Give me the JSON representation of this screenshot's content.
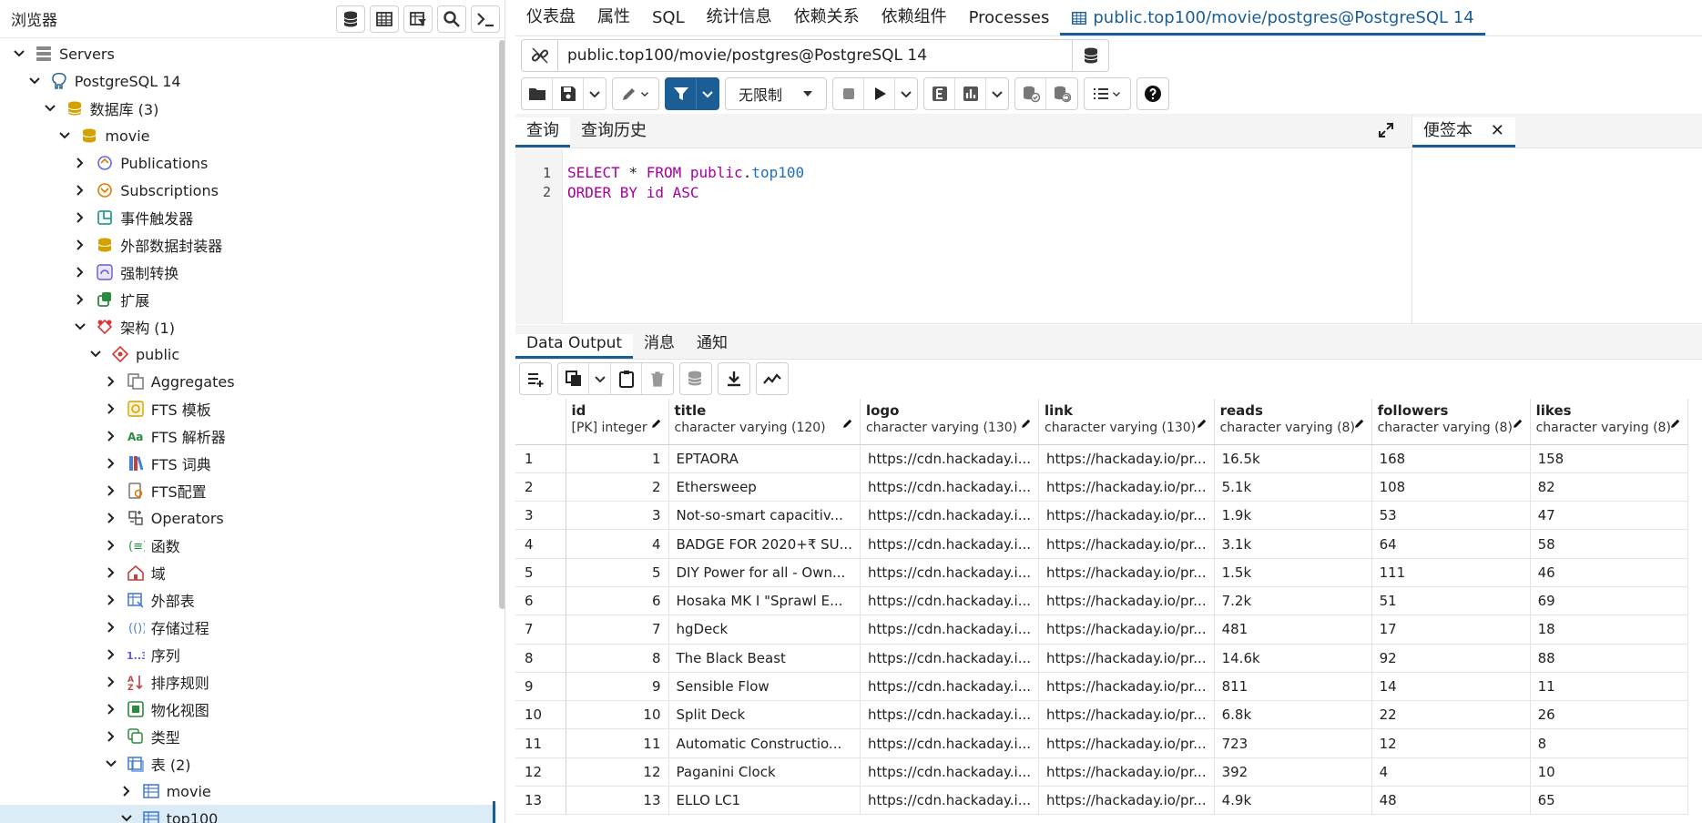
{
  "browser": {
    "title": "浏览器",
    "tree": [
      {
        "label": "Servers",
        "level": 0,
        "expanded": true,
        "icon": "servers-icon"
      },
      {
        "label": "PostgreSQL 14",
        "level": 1,
        "expanded": true,
        "icon": "postgres-elephant-icon"
      },
      {
        "label": "数据库 (3)",
        "level": 2,
        "expanded": true,
        "icon": "databases-icon"
      },
      {
        "label": "movie",
        "level": 3,
        "expanded": true,
        "icon": "database-icon"
      },
      {
        "label": "Publications",
        "level": 4,
        "expanded": false,
        "icon": "publications-icon"
      },
      {
        "label": "Subscriptions",
        "level": 4,
        "expanded": false,
        "icon": "subscriptions-icon"
      },
      {
        "label": "事件触发器",
        "level": 4,
        "expanded": false,
        "icon": "event-trigger-icon"
      },
      {
        "label": "外部数据封装器",
        "level": 4,
        "expanded": false,
        "icon": "foreign-data-wrapper-icon"
      },
      {
        "label": "强制转换",
        "level": 4,
        "expanded": false,
        "icon": "cast-icon"
      },
      {
        "label": "扩展",
        "level": 4,
        "expanded": false,
        "icon": "extension-icon"
      },
      {
        "label": "架构 (1)",
        "level": 4,
        "expanded": true,
        "icon": "schemas-icon"
      },
      {
        "label": "public",
        "level": 5,
        "expanded": true,
        "icon": "schema-icon"
      },
      {
        "label": "Aggregates",
        "level": 6,
        "expanded": false,
        "icon": "aggregates-icon"
      },
      {
        "label": "FTS 模板",
        "level": 6,
        "expanded": false,
        "icon": "fts-template-icon"
      },
      {
        "label": "FTS 解析器",
        "level": 6,
        "expanded": false,
        "icon": "fts-parser-icon"
      },
      {
        "label": "FTS 词典",
        "level": 6,
        "expanded": false,
        "icon": "fts-dictionary-icon"
      },
      {
        "label": "FTS配置",
        "level": 6,
        "expanded": false,
        "icon": "fts-config-icon"
      },
      {
        "label": "Operators",
        "level": 6,
        "expanded": false,
        "icon": "operators-icon"
      },
      {
        "label": "函数",
        "level": 6,
        "expanded": false,
        "icon": "functions-icon"
      },
      {
        "label": "域",
        "level": 6,
        "expanded": false,
        "icon": "domain-icon"
      },
      {
        "label": "外部表",
        "level": 6,
        "expanded": false,
        "icon": "foreign-table-icon"
      },
      {
        "label": "存储过程",
        "level": 6,
        "expanded": false,
        "icon": "procedures-icon"
      },
      {
        "label": "序列",
        "level": 6,
        "expanded": false,
        "icon": "sequences-icon"
      },
      {
        "label": "排序规则",
        "level": 6,
        "expanded": false,
        "icon": "collation-icon"
      },
      {
        "label": "物化视图",
        "level": 6,
        "expanded": false,
        "icon": "materialized-view-icon"
      },
      {
        "label": "类型",
        "level": 6,
        "expanded": false,
        "icon": "types-icon"
      },
      {
        "label": "表 (2)",
        "level": 6,
        "expanded": true,
        "icon": "tables-icon"
      },
      {
        "label": "movie",
        "level": 7,
        "expanded": false,
        "icon": "table-icon"
      },
      {
        "label": "top100",
        "level": 7,
        "expanded": true,
        "icon": "table-icon",
        "selected": true
      }
    ]
  },
  "top_tabs": [
    "仪表盘",
    "属性",
    "SQL",
    "统计信息",
    "依赖关系",
    "依赖组件",
    "Processes"
  ],
  "active_tab": "public.top100/movie/postgres@PostgreSQL 14",
  "connection": "public.top100/movie/postgres@PostgreSQL 14",
  "limit": "无限制",
  "query_tabs": [
    "查询",
    "查询历史"
  ],
  "notes_tab": "便签本",
  "sql_lines": [
    "1",
    "2"
  ],
  "output_tabs": [
    "Data Output",
    "消息",
    "通知"
  ],
  "grid": {
    "columns": [
      {
        "name": "id",
        "type": "[PK] integer"
      },
      {
        "name": "title",
        "type": "character varying (120)"
      },
      {
        "name": "logo",
        "type": "character varying (130)"
      },
      {
        "name": "link",
        "type": "character varying (130)"
      },
      {
        "name": "reads",
        "type": "character varying (8)"
      },
      {
        "name": "followers",
        "type": "character varying (8)"
      },
      {
        "name": "likes",
        "type": "character varying (8)"
      }
    ],
    "rows": [
      [
        "1",
        "1",
        "EPTAORA",
        "https://cdn.hackaday.i...",
        "https://hackaday.io/pr...",
        "16.5k",
        "168",
        "158"
      ],
      [
        "2",
        "2",
        "Ethersweep",
        "https://cdn.hackaday.i...",
        "https://hackaday.io/pr...",
        "5.1k",
        "108",
        "82"
      ],
      [
        "3",
        "3",
        "Not-so-smart capacitiv...",
        "https://cdn.hackaday.i...",
        "https://hackaday.io/pr...",
        "1.9k",
        "53",
        "47"
      ],
      [
        "4",
        "4",
        "BADGE FOR 2020+₹ SU...",
        "https://cdn.hackaday.i...",
        "https://hackaday.io/pr...",
        "3.1k",
        "64",
        "58"
      ],
      [
        "5",
        "5",
        "DIY Power for all - Own...",
        "https://cdn.hackaday.i...",
        "https://hackaday.io/pr...",
        "1.5k",
        "111",
        "46"
      ],
      [
        "6",
        "6",
        "Hosaka MK I \"Sprawl E...",
        "https://cdn.hackaday.i...",
        "https://hackaday.io/pr...",
        "7.2k",
        "51",
        "69"
      ],
      [
        "7",
        "7",
        "hgDeck",
        "https://cdn.hackaday.i...",
        "https://hackaday.io/pr...",
        "481",
        "17",
        "18"
      ],
      [
        "8",
        "8",
        "The Black Beast",
        "https://cdn.hackaday.i...",
        "https://hackaday.io/pr...",
        "14.6k",
        "92",
        "88"
      ],
      [
        "9",
        "9",
        "Sensible Flow",
        "https://cdn.hackaday.i...",
        "https://hackaday.io/pr...",
        "811",
        "14",
        "11"
      ],
      [
        "10",
        "10",
        "Split Deck",
        "https://cdn.hackaday.i...",
        "https://hackaday.io/pr...",
        "6.8k",
        "22",
        "26"
      ],
      [
        "11",
        "11",
        "Automatic Constructio...",
        "https://cdn.hackaday.i...",
        "https://hackaday.io/pr...",
        "723",
        "12",
        "8"
      ],
      [
        "12",
        "12",
        "Paganini Clock",
        "https://cdn.hackaday.i...",
        "https://hackaday.io/pr...",
        "392",
        "4",
        "10"
      ],
      [
        "13",
        "13",
        "ELLO LC1",
        "https://cdn.hackaday.i...",
        "https://hackaday.io/pr...",
        "4.9k",
        "48",
        "65"
      ]
    ]
  },
  "colors": {
    "accent": "#1b5e96",
    "keyword": "#a4009e",
    "identifier": "#1b70b8"
  }
}
